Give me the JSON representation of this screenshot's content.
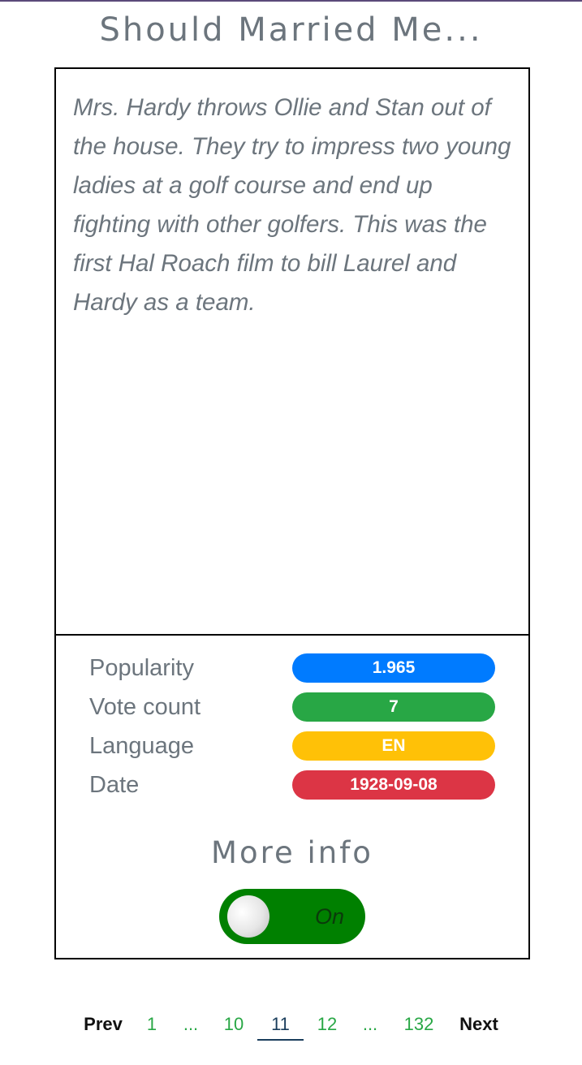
{
  "header": {
    "title": "Should Married Me..."
  },
  "movie": {
    "overview": "Mrs. Hardy throws Ollie and Stan out of the house. They try to impress two young ladies at a golf course and end up fighting with other golfers. This was the first Hal Roach film to bill Laurel and Hardy as a team."
  },
  "stats": [
    {
      "label": "Popularity",
      "value": "1.965",
      "color": "#007bff"
    },
    {
      "label": "Vote count",
      "value": "7",
      "color": "#28a745"
    },
    {
      "label": "Language",
      "value": "EN",
      "color": "#ffc107"
    },
    {
      "label": "Date",
      "value": "1928-09-08",
      "color": "#dc3545"
    }
  ],
  "more_info": {
    "label": "More info",
    "toggle_text": "On",
    "toggle_color": "#008000"
  },
  "pagination": {
    "prev": "Prev",
    "next": "Next",
    "pages": [
      "1",
      "...",
      "10",
      "11",
      "12",
      "...",
      "132"
    ],
    "current": "11"
  }
}
